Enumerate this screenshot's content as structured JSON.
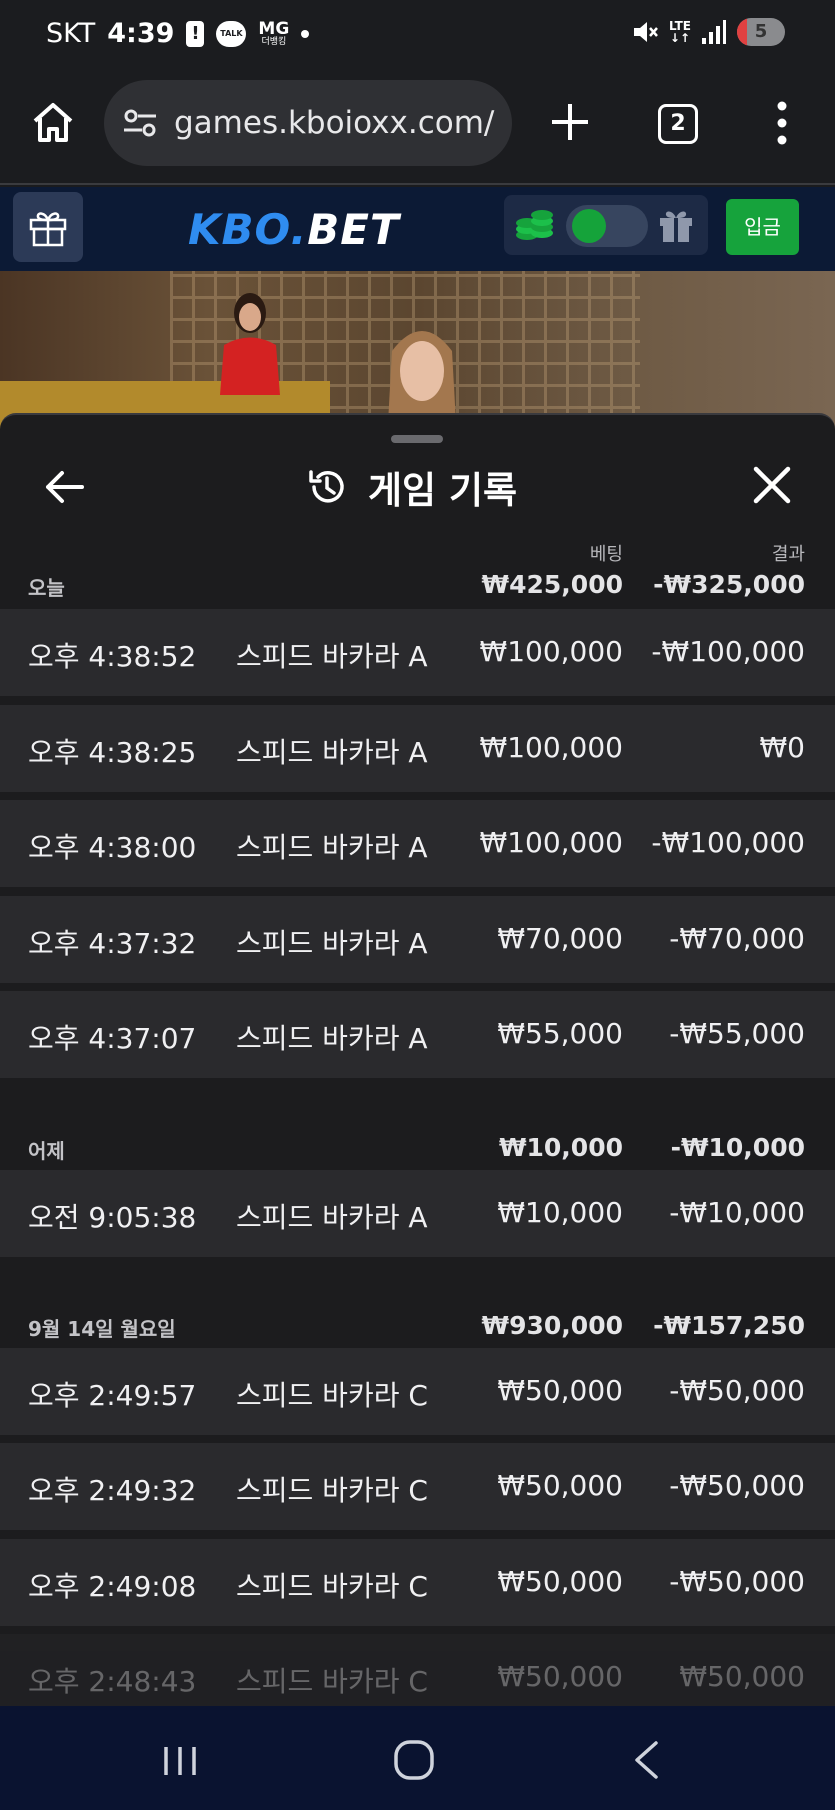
{
  "status_bar": {
    "carrier": "SKT",
    "time": "4:39",
    "talk_label": "TALK",
    "mg_label": "MG",
    "mg_sub": "더뱅킹",
    "lte_label": "LTE",
    "battery": "5"
  },
  "browser": {
    "url": "games.kboioxx.com/",
    "tab_count": "2"
  },
  "site_header": {
    "logo_part1": "KBO.",
    "logo_part2": "BET",
    "deposit_label": "입금",
    "accent_color": "#2f8cf0",
    "deposit_color": "#16a33c"
  },
  "panel": {
    "title": "게임 기록",
    "col_bet": "베팅",
    "col_result": "결과"
  },
  "sections": [
    {
      "label": "오늘",
      "bet_total": "₩425,000",
      "result_total": "-₩325,000",
      "rows": [
        {
          "time": "오후 4:38:52",
          "game": "스피드 바카라 A",
          "bet": "₩100,000",
          "result": "-₩100,000"
        },
        {
          "time": "오후 4:38:25",
          "game": "스피드 바카라 A",
          "bet": "₩100,000",
          "result": "₩0"
        },
        {
          "time": "오후 4:38:00",
          "game": "스피드 바카라 A",
          "bet": "₩100,000",
          "result": "-₩100,000"
        },
        {
          "time": "오후 4:37:32",
          "game": "스피드 바카라 A",
          "bet": "₩70,000",
          "result": "-₩70,000"
        },
        {
          "time": "오후 4:37:07",
          "game": "스피드 바카라 A",
          "bet": "₩55,000",
          "result": "-₩55,000"
        }
      ]
    },
    {
      "label": "어제",
      "bet_total": "₩10,000",
      "result_total": "-₩10,000",
      "rows": [
        {
          "time": "오전 9:05:38",
          "game": "스피드 바카라 A",
          "bet": "₩10,000",
          "result": "-₩10,000"
        }
      ]
    },
    {
      "label": "9월 14일 월요일",
      "bet_total": "₩930,000",
      "result_total": "-₩157,250",
      "rows": [
        {
          "time": "오후 2:49:57",
          "game": "스피드 바카라 C",
          "bet": "₩50,000",
          "result": "-₩50,000"
        },
        {
          "time": "오후 2:49:32",
          "game": "스피드 바카라 C",
          "bet": "₩50,000",
          "result": "-₩50,000"
        },
        {
          "time": "오후 2:49:08",
          "game": "스피드 바카라 C",
          "bet": "₩50,000",
          "result": "-₩50,000"
        },
        {
          "time": "오후 2:48:43",
          "game": "스피드 바카라 C",
          "bet": "₩50,000",
          "result": "₩50,000"
        }
      ]
    }
  ]
}
